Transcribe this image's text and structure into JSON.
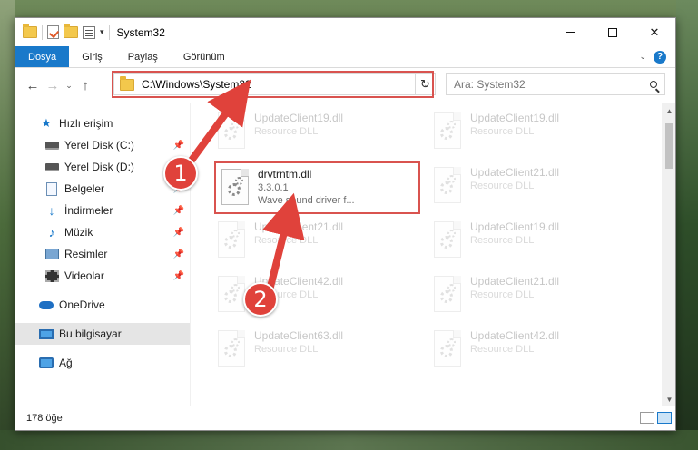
{
  "window": {
    "title": "System32",
    "controls": {
      "minimize": "—",
      "maximize": "☐",
      "close": "✕"
    }
  },
  "ribbon": {
    "tabs": [
      {
        "label": "Dosya",
        "active": true
      },
      {
        "label": "Giriş",
        "active": false
      },
      {
        "label": "Paylaş",
        "active": false
      },
      {
        "label": "Görünüm",
        "active": false
      }
    ],
    "help": "?"
  },
  "nav": {
    "back": "←",
    "forward": "→",
    "recent": "⌄",
    "up": "↑",
    "address": "C:\\Windows\\System32",
    "refresh": "↻",
    "dropdown": "⌄"
  },
  "search": {
    "placeholder": "Ara: System32"
  },
  "sidebar": {
    "items": [
      {
        "label": "Hızlı erişim"
      },
      {
        "label": "Yerel Disk (C:)",
        "pinned": true
      },
      {
        "label": "Yerel Disk (D:)",
        "pinned": true
      },
      {
        "label": "Belgeler",
        "pinned": true
      },
      {
        "label": "İndirmeler",
        "pinned": true
      },
      {
        "label": "Müzik",
        "pinned": true
      },
      {
        "label": "Resimler",
        "pinned": true
      },
      {
        "label": "Videolar",
        "pinned": true
      },
      {
        "label": "OneDrive"
      },
      {
        "label": "Bu bilgisayar",
        "selected": true
      },
      {
        "label": "Ağ"
      }
    ]
  },
  "files": {
    "highlighted": {
      "name": "drvtrntm.dll",
      "version": "3.3.0.1",
      "description": "Wave sound driver f..."
    },
    "background": [
      {
        "name": "UpdateClient19.dll",
        "type": "Resource DLL"
      },
      {
        "name": "UpdateClient19.dll",
        "type": "Resource DLL"
      },
      {
        "name": "UpdateClient21.dll",
        "type": "Resource DLL"
      },
      {
        "name": "UpdateClient21.dll",
        "type": "Resource DLL"
      },
      {
        "name": "UpdateClient19.dll",
        "type": "Resource DLL"
      },
      {
        "name": "UpdateClient42.dll",
        "type": "Resource DLL"
      },
      {
        "name": "UpdateClient21.dll",
        "type": "Resource DLL"
      },
      {
        "name": "UpdateClient63.dll",
        "type": "Resource DLL"
      },
      {
        "name": "UpdateClient42.dll",
        "type": "Resource DLL"
      }
    ]
  },
  "status": {
    "count": "178 öğe"
  },
  "callouts": {
    "one": "1",
    "two": "2"
  },
  "colors": {
    "accent": "#1979ca",
    "annotation": "#e0423b"
  }
}
